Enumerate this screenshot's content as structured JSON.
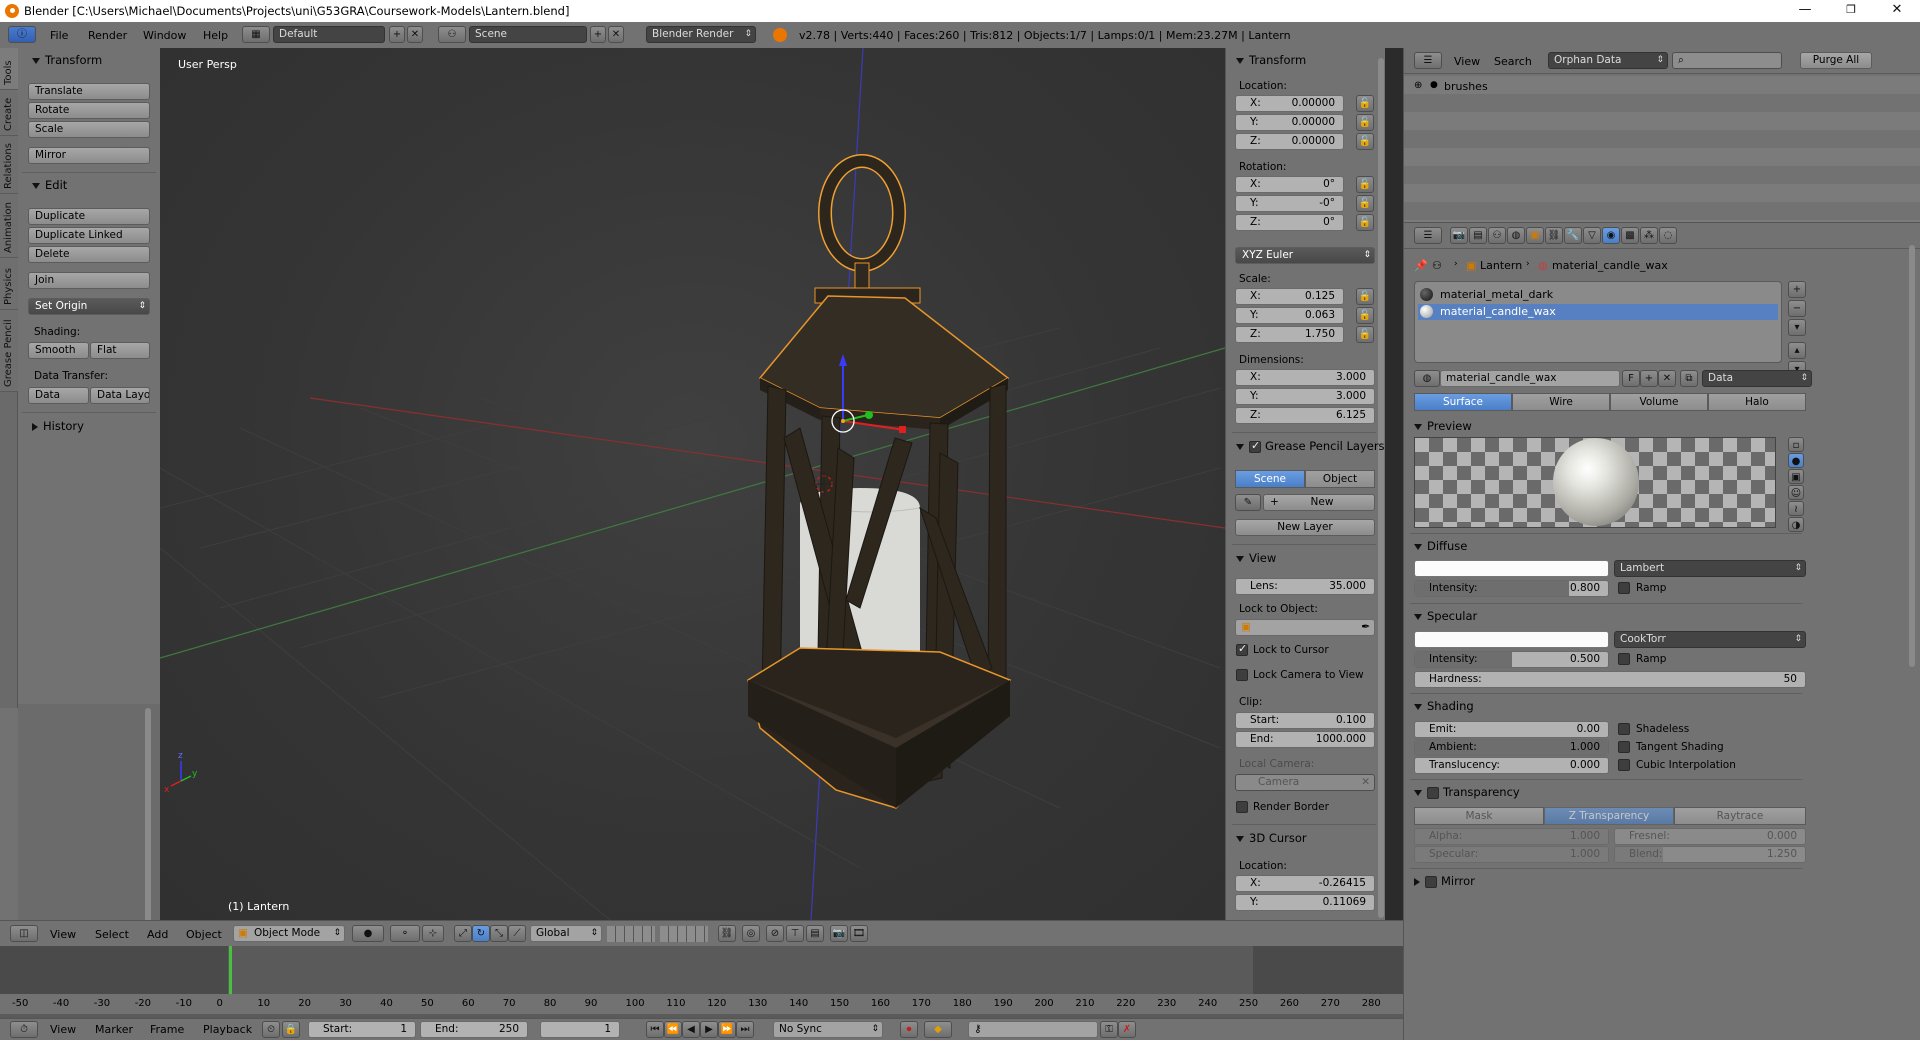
{
  "window": {
    "title": "Blender  [C:\\Users\\Michael\\Documents\\Projects\\uni\\G53GRA\\Coursework-Models\\Lantern.blend]",
    "minimize": "—",
    "maximize": "❐",
    "close": "✕"
  },
  "infobar": {
    "menus": [
      "File",
      "Render",
      "Window",
      "Help"
    ],
    "screen_layout": "Default",
    "scene": "Scene",
    "render_engine": "Blender Render",
    "stats": "v2.78 | Verts:440 | Faces:260 | Tris:812 | Objects:1/7 | Lamps:0/1 | Mem:23.27M | Lantern"
  },
  "tool_tabs": [
    "Tools",
    "Create",
    "Relations",
    "Animation",
    "Physics",
    "Grease Pencil"
  ],
  "tools": {
    "transform_header": "Transform",
    "translate": "Translate",
    "rotate": "Rotate",
    "scale": "Scale",
    "mirror": "Mirror",
    "edit_header": "Edit",
    "duplicate": "Duplicate",
    "duplicate_linked": "Duplicate Linked",
    "delete": "Delete",
    "join": "Join",
    "set_origin": "Set Origin",
    "shading_label": "Shading:",
    "smooth": "Smooth",
    "flat": "Flat",
    "data_transfer_label": "Data Transfer:",
    "data": "Data",
    "data_layout": "Data Layo",
    "history_header": "History"
  },
  "viewport": {
    "view_name": "User Persp",
    "object_name": "(1) Lantern"
  },
  "npanel": {
    "transform_header": "Transform",
    "location_label": "Location:",
    "loc": [
      {
        "axis": "X:",
        "value": "0.00000"
      },
      {
        "axis": "Y:",
        "value": "0.00000"
      },
      {
        "axis": "Z:",
        "value": "0.00000"
      }
    ],
    "rotation_label": "Rotation:",
    "rot": [
      {
        "axis": "X:",
        "value": "0°"
      },
      {
        "axis": "Y:",
        "value": "-0°"
      },
      {
        "axis": "Z:",
        "value": "0°"
      }
    ],
    "rotation_mode": "XYZ Euler",
    "scale_label": "Scale:",
    "scl": [
      {
        "axis": "X:",
        "value": "0.125"
      },
      {
        "axis": "Y:",
        "value": "0.063"
      },
      {
        "axis": "Z:",
        "value": "1.750"
      }
    ],
    "dimensions_label": "Dimensions:",
    "dim": [
      {
        "axis": "X:",
        "value": "3.000"
      },
      {
        "axis": "Y:",
        "value": "3.000"
      },
      {
        "axis": "Z:",
        "value": "6.125"
      }
    ],
    "gp_header": "Grease Pencil Layers",
    "gp_scene": "Scene",
    "gp_object": "Object",
    "gp_new": "New",
    "gp_new_layer": "New Layer",
    "view_header": "View",
    "lens_label": "Lens:",
    "lens_value": "35.000",
    "lock_to_object": "Lock to Object:",
    "lock_to_cursor": "Lock to Cursor",
    "lock_camera": "Lock Camera to View",
    "clip_label": "Clip:",
    "clip_start_label": "Start:",
    "clip_start": "0.100",
    "clip_end_label": "End:",
    "clip_end": "1000.000",
    "local_camera": "Local Camera:",
    "camera": "Camera",
    "render_border": "Render Border",
    "cursor_header": "3D Cursor",
    "cursor_location": "Location:",
    "cursor": [
      {
        "axis": "X:",
        "value": "-0.26415"
      },
      {
        "axis": "Y:",
        "value": "0.11069"
      }
    ]
  },
  "vpheader": {
    "view": "View",
    "select": "Select",
    "add": "Add",
    "object": "Object",
    "mode": "Object Mode",
    "orientation": "Global"
  },
  "timeline": {
    "ticks": [
      "-50",
      "-40",
      "-30",
      "-20",
      "-10",
      "0",
      "10",
      "20",
      "30",
      "40",
      "50",
      "60",
      "70",
      "80",
      "90",
      "100",
      "110",
      "120",
      "130",
      "140",
      "150",
      "160",
      "170",
      "180",
      "190",
      "200",
      "210",
      "220",
      "230",
      "240",
      "250",
      "260",
      "270",
      "280"
    ],
    "menus": [
      "View",
      "Marker",
      "Frame",
      "Playback"
    ],
    "start_label": "Start:",
    "start": "1",
    "end_label": "End:",
    "end": "250",
    "current": "1",
    "sync": "No Sync"
  },
  "outliner": {
    "view": "View",
    "search": "Search",
    "display_mode": "Orphan Data",
    "purge": "Purge All",
    "item": "brushes"
  },
  "props": {
    "breadcrumb_obj": "Lantern",
    "breadcrumb_mat": "material_candle_wax",
    "slots": [
      "material_metal_dark",
      "material_candle_wax"
    ],
    "material_name": "material_candle_wax",
    "fake_user": "F",
    "link": "Data",
    "tabs": [
      "Surface",
      "Wire",
      "Volume",
      "Halo"
    ],
    "preview_header": "Preview",
    "diffuse_header": "Diffuse",
    "diffuse_shader": "Lambert",
    "intensity_label": "Intensity:",
    "diffuse_intensity": "0.800",
    "ramp": "Ramp",
    "specular_header": "Specular",
    "specular_shader": "CookTorr",
    "specular_intensity": "0.500",
    "hardness_label": "Hardness:",
    "hardness": "50",
    "shading_header": "Shading",
    "emit_label": "Emit:",
    "emit": "0.00",
    "ambient_label": "Ambient:",
    "ambient": "1.000",
    "translucency_label": "Translucency:",
    "translucency": "0.000",
    "shadeless": "Shadeless",
    "tangent": "Tangent Shading",
    "cubic": "Cubic Interpolation",
    "transparency_header": "Transparency",
    "trans_tabs": [
      "Mask",
      "Z Transparency",
      "Raytrace"
    ],
    "alpha_label": "Alpha:",
    "alpha": "1.000",
    "fresnel_label": "Fresnel:",
    "fresnel": "0.000",
    "specular_label": "Specular:",
    "specular": "1.000",
    "blend_label": "Blend:",
    "blend": "1.250",
    "mirror_header": "Mirror"
  }
}
